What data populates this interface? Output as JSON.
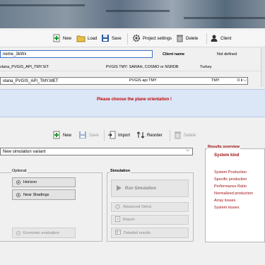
{
  "top_toolbar": {
    "new": "New",
    "load": "Load",
    "save": "Save",
    "project_settings": "Project settings",
    "delete": "Delete",
    "client": "Client"
  },
  "project": {
    "name_value": "neme_3kWx",
    "client_name_label": "Client name",
    "client_name_value": "Not defined"
  },
  "site_row": {
    "file": "vlana_PVGIS_API_TMY.SIT",
    "source": "PVGIS TMY: SARAH, COSMO or NSRDB",
    "country": "Turkey"
  },
  "meteo_row": {
    "file": "vlana_PVGIS_API_TMY.MET",
    "source": "PVGIS api TMY",
    "type": "TMY",
    "extra": "0 k"
  },
  "message": "Please choose the plane orientation !",
  "variant_toolbar": {
    "new": "New",
    "save": "Save",
    "import": "Import",
    "reorder": "Reorder",
    "delete": "Delete"
  },
  "variant": {
    "selected": "New simulation variant"
  },
  "optional": {
    "title": "Optional",
    "horizon": "Horizon",
    "near_shadings": "Near Shadings",
    "economic": "Economic evaluation"
  },
  "simulation": {
    "title": "Simulation",
    "run": "Run Simulation",
    "advanced": "Advanced Simul.",
    "report": "Report",
    "detailed": "Detailed results"
  },
  "results": {
    "title": "Results overview",
    "kind": "System kind",
    "items": [
      "System Production",
      "Specific production",
      "Performance Ratio",
      "Normalized production",
      "Array losses",
      "System losses"
    ]
  },
  "colors": {
    "message_red": "#c00000",
    "results_red": "#a01010",
    "band_blue": "#dbe6f7"
  }
}
